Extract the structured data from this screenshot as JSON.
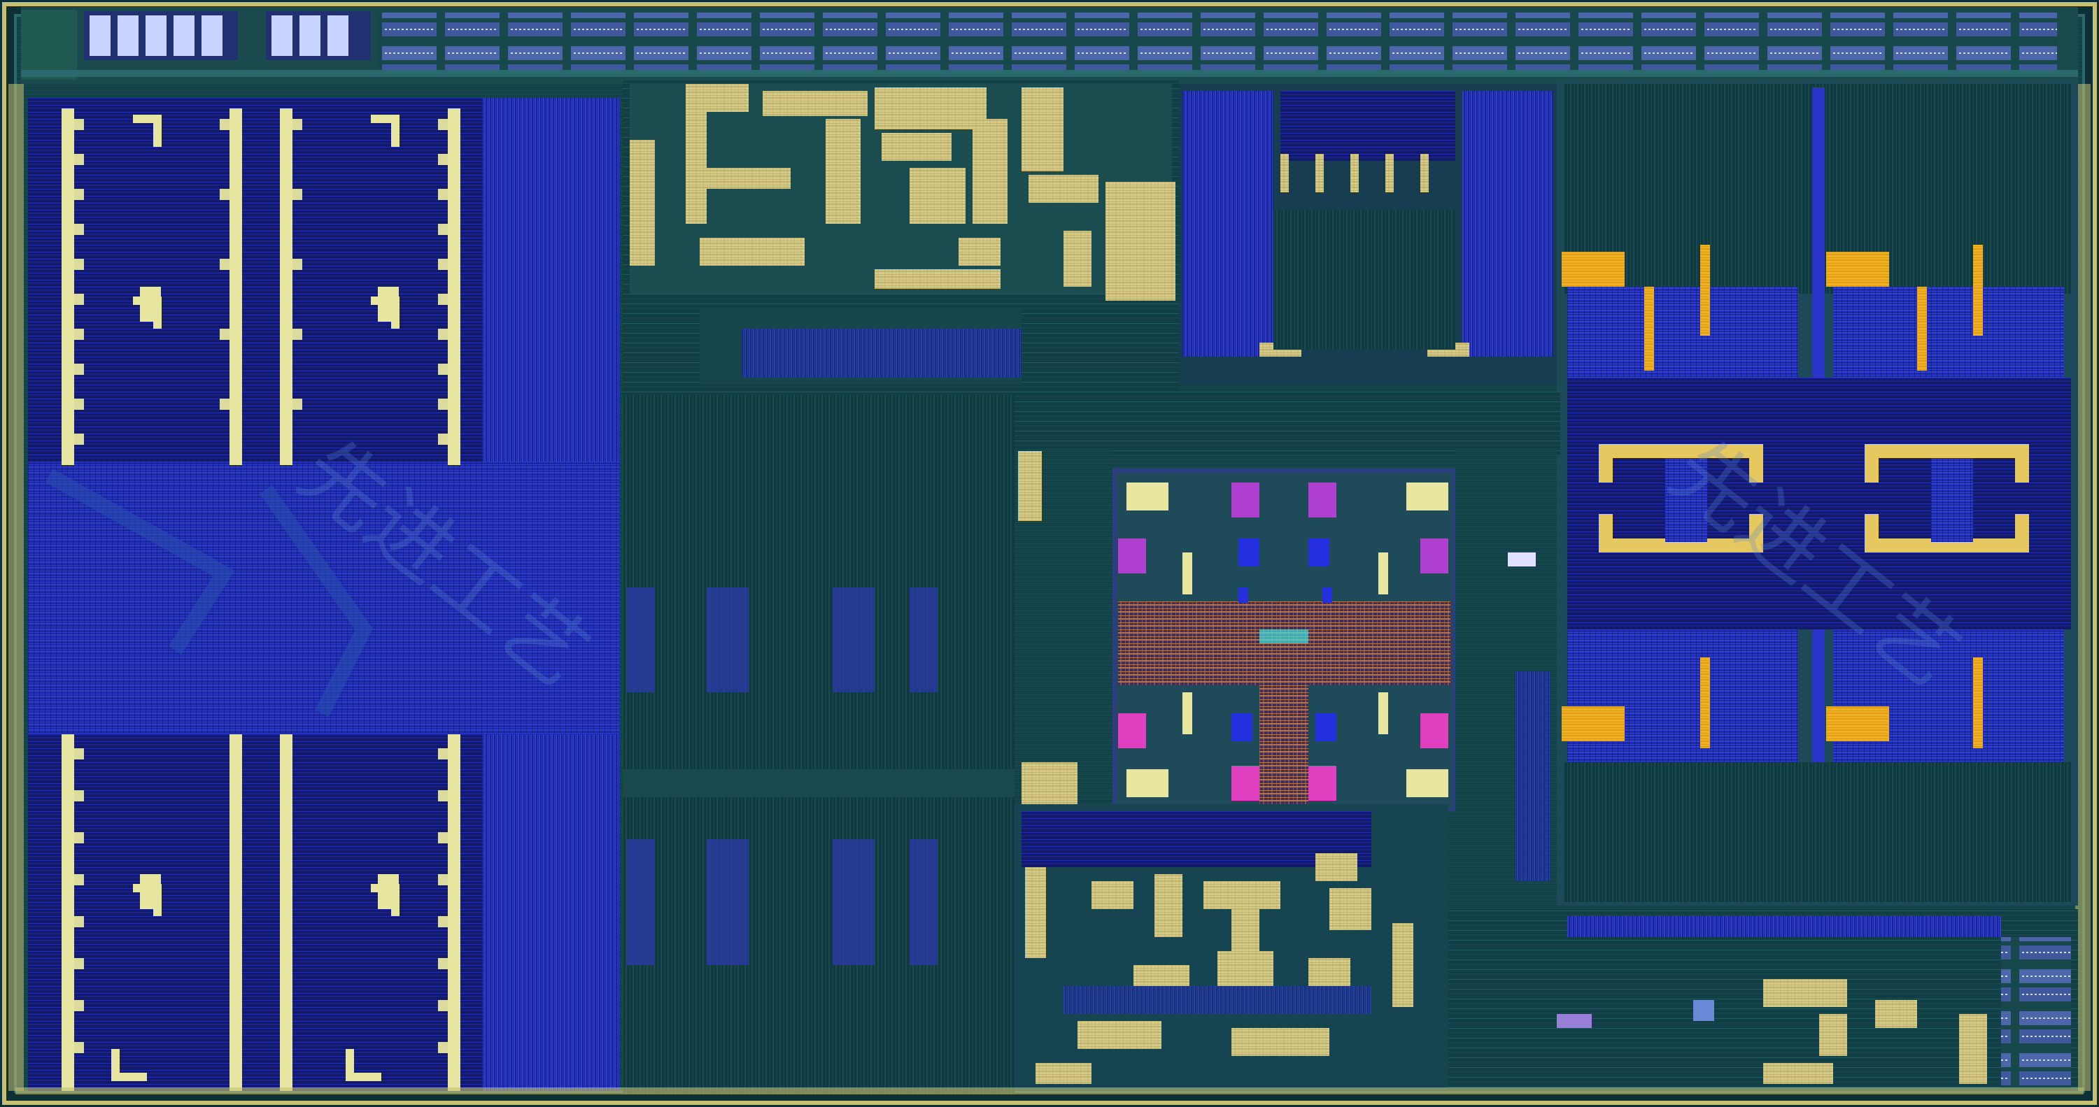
{
  "image": {
    "subject": "silicon-die-shot",
    "colors": {
      "substrate": "#123f45",
      "substrate_dark": "#0d2f36",
      "frame": "#1a4a4e",
      "edge_gold": "#c8c070",
      "cache_blue": "#2a34c8",
      "cache_navy": "#141a6a",
      "cache_bright": "#3a4cff",
      "pale_yellow": "#e6e6a0",
      "cream": "#f2e6b8",
      "gold": "#f0b020",
      "magenta": "#b040d0",
      "pink": "#e040c0",
      "orange": "#e08a40",
      "cyan": "#40e0e0",
      "grid_line": "#1f5d62",
      "fine_line": "#3b7a7e"
    },
    "watermark": {
      "left": "先进工艺",
      "right": "先进工艺"
    }
  }
}
